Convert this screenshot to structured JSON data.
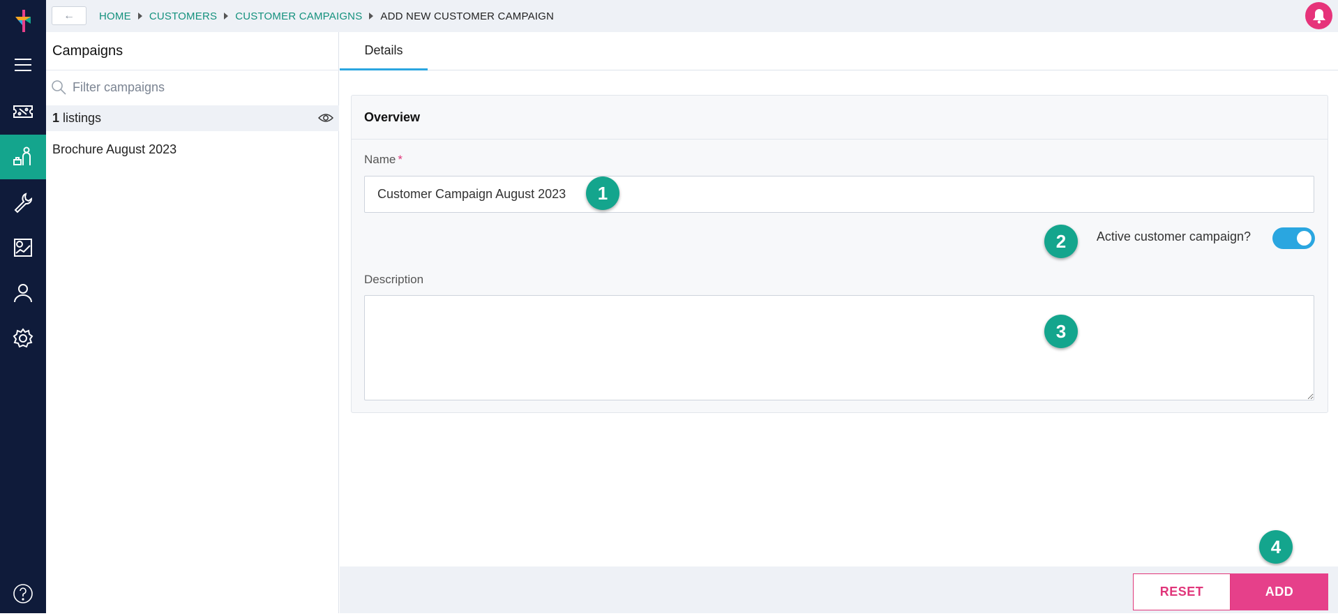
{
  "nav": {
    "items": [
      {
        "icon": "menu-icon"
      },
      {
        "icon": "ticket-icon"
      },
      {
        "icon": "customers-icon",
        "active": true
      },
      {
        "icon": "wrench-icon"
      },
      {
        "icon": "report-icon"
      },
      {
        "icon": "user-icon"
      },
      {
        "icon": "settings-icon"
      },
      {
        "icon": "help-icon"
      }
    ]
  },
  "topbar": {
    "back_label": "←",
    "breadcrumb": [
      "HOME",
      "CUSTOMERS",
      "CUSTOMER CAMPAIGNS",
      "ADD NEW CUSTOMER CAMPAIGN"
    ]
  },
  "sidebar": {
    "title": "Campaigns",
    "filter_placeholder": "Filter campaigns",
    "count": "1",
    "count_suffix": "listings",
    "items": [
      "Brochure August 2023"
    ]
  },
  "main": {
    "tabs": [
      "Details"
    ],
    "section_title": "Overview",
    "name_label": "Name",
    "required_mark": "*",
    "name_value": "Customer Campaign August 2023",
    "active_label": "Active customer campaign?",
    "active": true,
    "description_label": "Description",
    "description_value": ""
  },
  "markers": [
    "1",
    "2",
    "3",
    "4"
  ],
  "footer": {
    "reset_label": "RESET",
    "add_label": "ADD"
  },
  "colors": {
    "rail": "#0f1b3a",
    "accent_teal": "#14a58d",
    "accent_pink": "#e6408a",
    "toggle_blue": "#2aa6e0"
  }
}
